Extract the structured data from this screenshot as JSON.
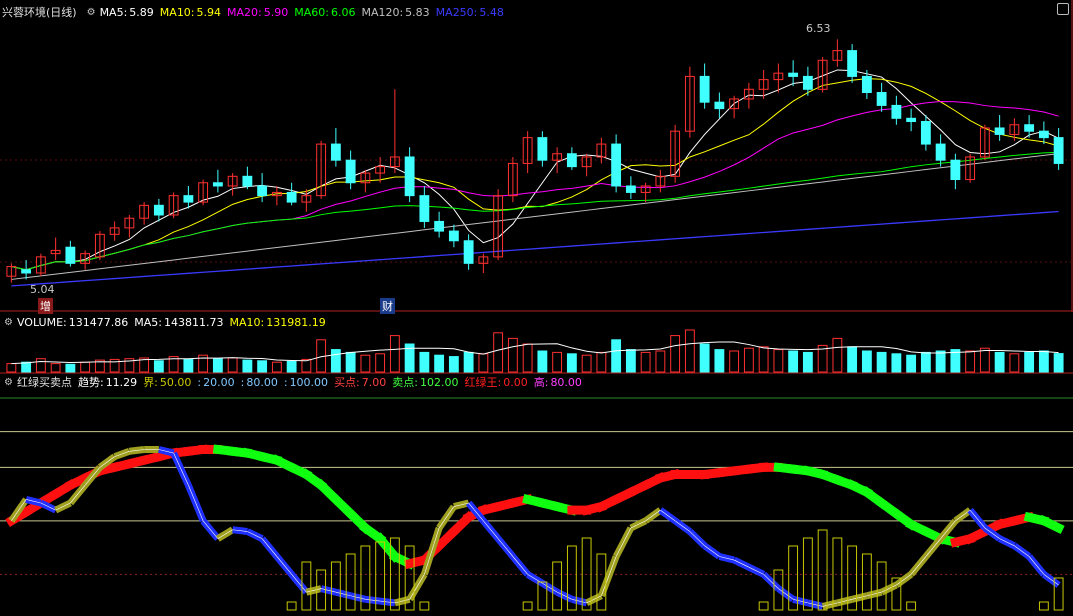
{
  "header": {
    "title": "兴蓉环境(日线)",
    "ma": [
      {
        "label": "MA5:",
        "value": "5.89",
        "color": "#ffffff"
      },
      {
        "label": "MA10:",
        "value": "5.94",
        "color": "#ffff00"
      },
      {
        "label": "MA20:",
        "value": "5.90",
        "color": "#ff00ff"
      },
      {
        "label": "MA60:",
        "value": "6.06",
        "color": "#00ff00"
      },
      {
        "label": "MA120:",
        "value": "5.83",
        "color": "#c0c0c0"
      },
      {
        "label": "MA250:",
        "value": "5.48",
        "color": "#3a3aff"
      }
    ]
  },
  "price_annotations": {
    "high": "6.53",
    "low": "5.04",
    "mark1": "增",
    "mark2": "财"
  },
  "volume_header": [
    {
      "label": "VOLUME:",
      "value": "131477.86",
      "color": "#ffffff"
    },
    {
      "label": "MA5:",
      "value": "143811.73",
      "color": "#ffffff"
    },
    {
      "label": "MA10:",
      "value": "131981.19",
      "color": "#ffff00"
    }
  ],
  "indicator_header": {
    "title": "红绿买卖点",
    "items": [
      {
        "label": "趋势:",
        "value": "11.29",
        "color": "#ffffff"
      },
      {
        "label": "界:",
        "value": "50.00",
        "color": "#c8c800"
      },
      {
        "label": ":",
        "value": "20.00",
        "color": "#80c8ff"
      },
      {
        "label": ":",
        "value": "80.00",
        "color": "#80c8ff"
      },
      {
        "label": ":",
        "value": "100.00",
        "color": "#80c8ff"
      },
      {
        "label": "买点:",
        "value": "7.00",
        "color": "#ff4040"
      },
      {
        "label": "卖点:",
        "value": "102.00",
        "color": "#40ff40"
      },
      {
        "label": "红绿王:",
        "value": "0.00",
        "color": "#ff2020"
      },
      {
        "label": "高:",
        "value": "80.00",
        "color": "#ff40ff"
      }
    ]
  },
  "chart_data": {
    "type": "candlestick",
    "price_ylim": [
      4.9,
      6.65
    ],
    "candles": [
      [
        5.06,
        5.14,
        5.02,
        5.12
      ],
      [
        5.1,
        5.16,
        5.04,
        5.08
      ],
      [
        5.08,
        5.2,
        5.06,
        5.18
      ],
      [
        5.2,
        5.3,
        5.16,
        5.22
      ],
      [
        5.24,
        5.28,
        5.12,
        5.14
      ],
      [
        5.14,
        5.22,
        5.1,
        5.2
      ],
      [
        5.18,
        5.34,
        5.16,
        5.32
      ],
      [
        5.32,
        5.4,
        5.28,
        5.36
      ],
      [
        5.36,
        5.44,
        5.3,
        5.42
      ],
      [
        5.42,
        5.52,
        5.38,
        5.5
      ],
      [
        5.5,
        5.54,
        5.4,
        5.44
      ],
      [
        5.44,
        5.58,
        5.42,
        5.56
      ],
      [
        5.56,
        5.62,
        5.48,
        5.52
      ],
      [
        5.52,
        5.66,
        5.5,
        5.64
      ],
      [
        5.64,
        5.72,
        5.58,
        5.62
      ],
      [
        5.62,
        5.7,
        5.56,
        5.68
      ],
      [
        5.68,
        5.74,
        5.6,
        5.62
      ],
      [
        5.62,
        5.7,
        5.52,
        5.56
      ],
      [
        5.56,
        5.62,
        5.5,
        5.58
      ],
      [
        5.58,
        5.64,
        5.5,
        5.52
      ],
      [
        5.52,
        5.6,
        5.46,
        5.56
      ],
      [
        5.56,
        5.9,
        5.54,
        5.88
      ],
      [
        5.88,
        5.98,
        5.74,
        5.78
      ],
      [
        5.78,
        5.84,
        5.6,
        5.64
      ],
      [
        5.64,
        5.72,
        5.58,
        5.7
      ],
      [
        5.7,
        5.8,
        5.64,
        5.74
      ],
      [
        5.74,
        6.22,
        5.7,
        5.8
      ],
      [
        5.8,
        5.86,
        5.52,
        5.56
      ],
      [
        5.56,
        5.62,
        5.36,
        5.4
      ],
      [
        5.4,
        5.46,
        5.3,
        5.34
      ],
      [
        5.34,
        5.38,
        5.24,
        5.28
      ],
      [
        5.28,
        5.32,
        5.1,
        5.14
      ],
      [
        5.14,
        5.2,
        5.08,
        5.18
      ],
      [
        5.18,
        5.6,
        5.16,
        5.56
      ],
      [
        5.56,
        5.8,
        5.52,
        5.76
      ],
      [
        5.76,
        5.96,
        5.7,
        5.92
      ],
      [
        5.92,
        5.96,
        5.74,
        5.78
      ],
      [
        5.78,
        5.86,
        5.7,
        5.82
      ],
      [
        5.82,
        5.86,
        5.72,
        5.74
      ],
      [
        5.74,
        5.82,
        5.68,
        5.8
      ],
      [
        5.8,
        5.92,
        5.76,
        5.88
      ],
      [
        5.88,
        5.94,
        5.58,
        5.62
      ],
      [
        5.62,
        5.68,
        5.54,
        5.58
      ],
      [
        5.58,
        5.64,
        5.52,
        5.62
      ],
      [
        5.62,
        5.72,
        5.58,
        5.68
      ],
      [
        5.68,
        6.0,
        5.64,
        5.96
      ],
      [
        5.96,
        6.36,
        5.92,
        6.3
      ],
      [
        6.3,
        6.38,
        6.1,
        6.14
      ],
      [
        6.14,
        6.2,
        6.04,
        6.1
      ],
      [
        6.1,
        6.18,
        6.04,
        6.16
      ],
      [
        6.16,
        6.26,
        6.1,
        6.22
      ],
      [
        6.22,
        6.34,
        6.16,
        6.28
      ],
      [
        6.28,
        6.38,
        6.2,
        6.32
      ],
      [
        6.32,
        6.4,
        6.24,
        6.3
      ],
      [
        6.3,
        6.36,
        6.18,
        6.22
      ],
      [
        6.22,
        6.42,
        6.2,
        6.4
      ],
      [
        6.4,
        6.53,
        6.36,
        6.46
      ],
      [
        6.46,
        6.5,
        6.26,
        6.3
      ],
      [
        6.3,
        6.34,
        6.16,
        6.2
      ],
      [
        6.2,
        6.26,
        6.08,
        6.12
      ],
      [
        6.12,
        6.18,
        6.0,
        6.04
      ],
      [
        6.04,
        6.1,
        5.96,
        6.02
      ],
      [
        6.02,
        6.06,
        5.84,
        5.88
      ],
      [
        5.88,
        5.94,
        5.74,
        5.78
      ],
      [
        5.78,
        5.82,
        5.6,
        5.66
      ],
      [
        5.66,
        5.82,
        5.64,
        5.8
      ],
      [
        5.8,
        6.0,
        5.78,
        5.98
      ],
      [
        5.98,
        6.06,
        5.9,
        5.94
      ],
      [
        5.94,
        6.04,
        5.9,
        6.0
      ],
      [
        6.0,
        6.06,
        5.92,
        5.96
      ],
      [
        5.96,
        6.02,
        5.88,
        5.92
      ],
      [
        5.92,
        5.98,
        5.72,
        5.76
      ]
    ],
    "volume_ylim": [
      0,
      520000
    ],
    "volume": [
      60,
      70,
      95,
      60,
      55,
      70,
      85,
      90,
      95,
      100,
      80,
      110,
      90,
      120,
      95,
      100,
      85,
      80,
      70,
      75,
      90,
      230,
      160,
      140,
      120,
      130,
      260,
      200,
      140,
      120,
      110,
      140,
      130,
      280,
      240,
      200,
      150,
      140,
      130,
      120,
      140,
      230,
      160,
      140,
      150,
      260,
      300,
      200,
      160,
      150,
      170,
      180,
      160,
      150,
      140,
      190,
      240,
      180,
      150,
      140,
      130,
      120,
      140,
      150,
      160,
      150,
      170,
      140,
      130,
      140,
      150,
      131.48
    ],
    "indicator_ylim": [
      0,
      120
    ],
    "indicator_levels": [
      20,
      50,
      80,
      100
    ],
    "red_green_line": [
      50,
      55,
      60,
      65,
      70,
      74,
      78,
      80,
      82,
      84,
      86,
      88,
      89,
      90,
      90,
      89,
      88,
      86,
      84,
      80,
      76,
      70,
      62,
      54,
      46,
      40,
      30,
      26,
      28,
      36,
      44,
      52,
      56,
      58,
      60,
      62,
      60,
      58,
      56,
      56,
      58,
      62,
      66,
      70,
      74,
      76,
      76,
      76,
      77,
      78,
      79,
      80,
      80,
      79,
      78,
      76,
      73,
      70,
      66,
      60,
      54,
      48,
      44,
      40,
      38,
      40,
      44,
      48,
      50,
      52,
      50,
      46
    ],
    "trend_line": [
      50,
      62,
      60,
      56,
      60,
      70,
      80,
      86,
      89,
      90,
      90,
      88,
      70,
      50,
      40,
      45,
      44,
      40,
      30,
      20,
      10,
      12,
      10,
      8,
      6,
      5,
      4,
      6,
      20,
      46,
      58,
      60,
      50,
      40,
      30,
      20,
      15,
      10,
      6,
      4,
      8,
      30,
      46,
      50,
      56,
      50,
      44,
      36,
      30,
      28,
      24,
      20,
      12,
      6,
      4,
      2,
      4,
      6,
      8,
      10,
      14,
      20,
      30,
      40,
      50,
      56,
      46,
      40,
      36,
      30,
      20,
      14
    ],
    "volume_bars_bottom": [
      0,
      0,
      0,
      0,
      0,
      0,
      0,
      0,
      0,
      0,
      0,
      0,
      0,
      0,
      0,
      0,
      0,
      0,
      0,
      0,
      0,
      0,
      0,
      0,
      0,
      0,
      0,
      0,
      0,
      0,
      0,
      0,
      0,
      0,
      0,
      0,
      0,
      0,
      0,
      0,
      0,
      0,
      0,
      0,
      0,
      0,
      0,
      0,
      0,
      0,
      0,
      0,
      0,
      0,
      0,
      0,
      0,
      0,
      0,
      0,
      0,
      0,
      0,
      0,
      0,
      0,
      0,
      0,
      0,
      0,
      0,
      0
    ]
  }
}
